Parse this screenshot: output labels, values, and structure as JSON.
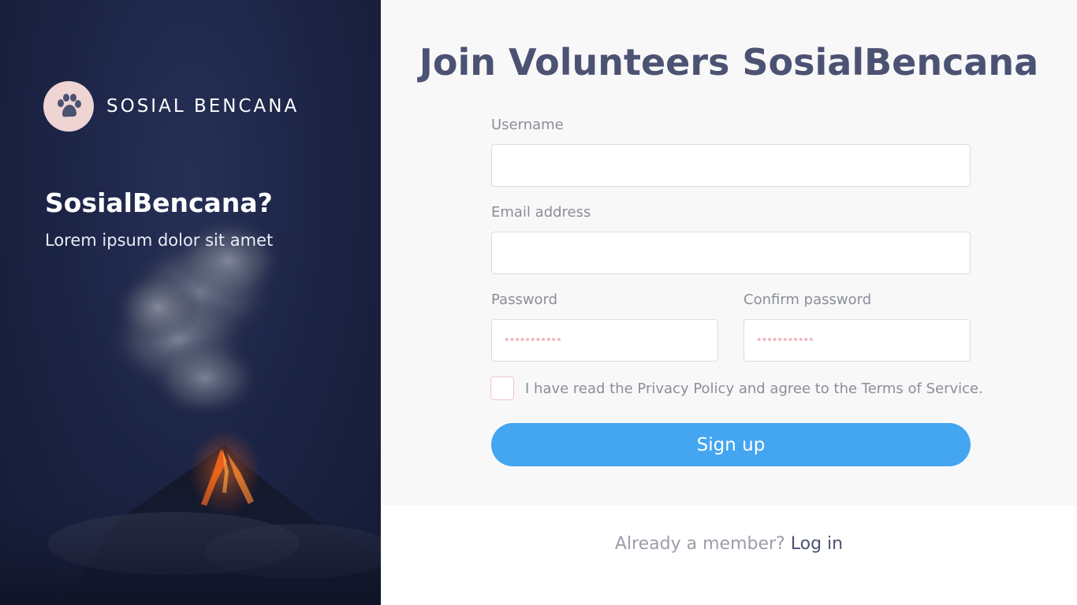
{
  "brand": {
    "logo_text": "SOSIAL BENCANA",
    "logo_icon": "paw-icon",
    "badge_color": "#efd4d4"
  },
  "hero": {
    "title": "SosialBencana?",
    "subtitle": "Lorem ipsum dolor sit amet",
    "background_image": "erupting-volcano-night"
  },
  "form": {
    "title": "Join Volunteers SosialBencana",
    "username": {
      "label": "Username",
      "value": "",
      "placeholder": ""
    },
    "email": {
      "label": "Email address",
      "value": "",
      "placeholder": ""
    },
    "password": {
      "label": "Password",
      "value": "",
      "placeholder": "•••••••••••"
    },
    "confirm_password": {
      "label": "Confirm password",
      "value": "",
      "placeholder": "•••••••••••"
    },
    "terms_text": "I have read the Privacy Policy and agree to the Terms of Service.",
    "terms_checked": false,
    "submit_label": "Sign up"
  },
  "footer": {
    "prompt": "Already a member?",
    "login_label": "Log in"
  },
  "colors": {
    "accent": "#44a5f1",
    "title": "#4c5272",
    "hero_background": "#1d2547"
  }
}
